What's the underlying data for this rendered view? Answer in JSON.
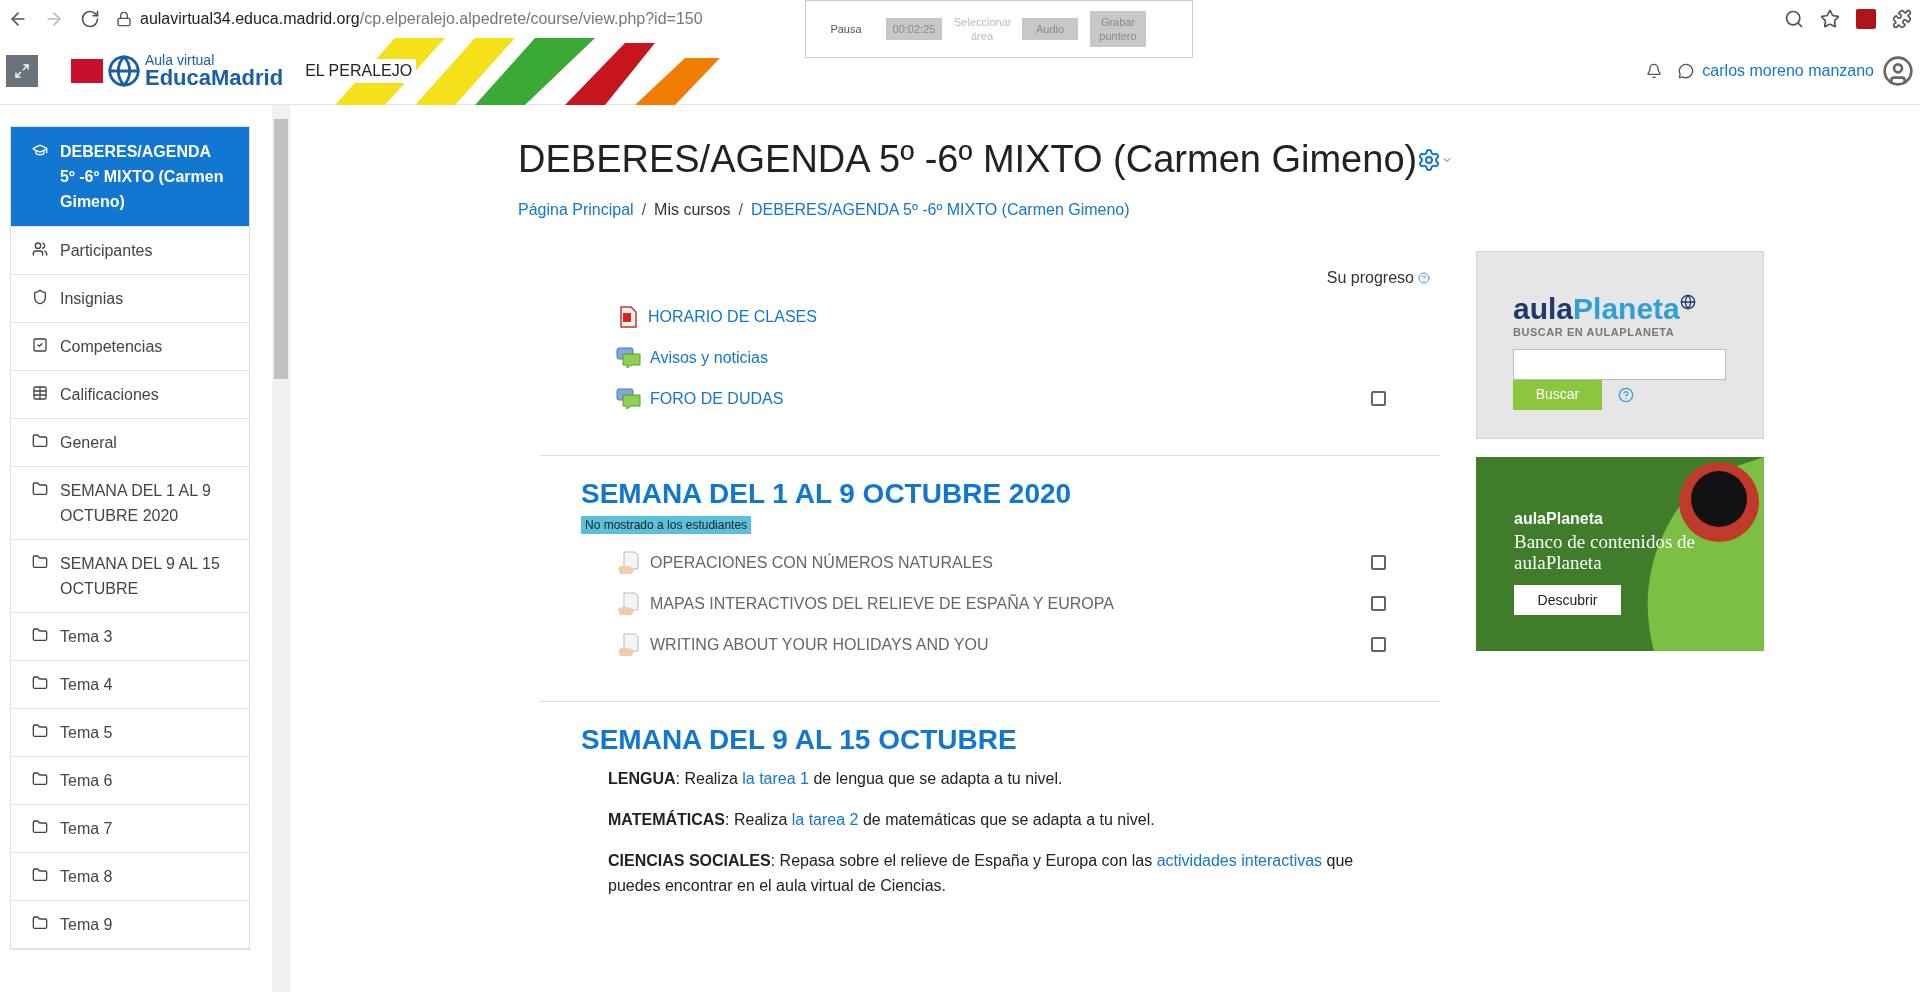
{
  "browser": {
    "url_host": "aulavirtual34.educa.madrid.org",
    "url_path": "/cp.elperalejo.alpedrete/course/view.php?id=150"
  },
  "recorder": [
    {
      "label": "Pausa",
      "kind": "plain"
    },
    {
      "label": "00:02:25",
      "kind": "boxed"
    },
    {
      "label": "Seleccionar área",
      "kind": "disabled"
    },
    {
      "label": "Audio",
      "kind": "boxed"
    },
    {
      "label": "Grabar puntero",
      "kind": "boxed"
    }
  ],
  "header": {
    "logo_small": "Aula virtual",
    "logo_big": "EducaMadrid",
    "site": "EL PERALEJO",
    "user": "carlos moreno manzano"
  },
  "sidebar": [
    {
      "label": "DEBERES/AGENDA 5º -6º MIXTO (Carmen Gimeno)",
      "kind": "course",
      "selected": true
    },
    {
      "label": "Participantes",
      "kind": "participants",
      "selected": false
    },
    {
      "label": "Insignias",
      "kind": "badges",
      "selected": false
    },
    {
      "label": "Competencias",
      "kind": "competencies",
      "selected": false
    },
    {
      "label": "Calificaciones",
      "kind": "grades",
      "selected": false
    },
    {
      "label": "General",
      "kind": "folder",
      "selected": false
    },
    {
      "label": "SEMANA DEL 1 AL 9 OCTUBRE 2020",
      "kind": "folder",
      "selected": false
    },
    {
      "label": "SEMANA DEL 9 AL 15 OCTUBRE",
      "kind": "folder",
      "selected": false
    },
    {
      "label": "Tema 3",
      "kind": "folder",
      "selected": false
    },
    {
      "label": "Tema 4",
      "kind": "folder",
      "selected": false
    },
    {
      "label": "Tema 5",
      "kind": "folder",
      "selected": false
    },
    {
      "label": "Tema 6",
      "kind": "folder",
      "selected": false
    },
    {
      "label": "Tema 7",
      "kind": "folder",
      "selected": false
    },
    {
      "label": "Tema 8",
      "kind": "folder",
      "selected": false
    },
    {
      "label": "Tema 9",
      "kind": "folder",
      "selected": false
    }
  ],
  "course": {
    "title": "DEBERES/AGENDA 5º -6º MIXTO (Carmen Gimeno)",
    "breadcrumb": [
      {
        "label": "Página Principal",
        "kind": "link"
      },
      {
        "label": "Mis cursos",
        "kind": "text"
      },
      {
        "label": "DEBERES/AGENDA 5º -6º MIXTO (Carmen Gimeno)",
        "kind": "link"
      }
    ],
    "separator": "/",
    "progress_label": "Su progreso"
  },
  "sections": [
    {
      "activities": [
        {
          "label": "HORARIO DE CLASES",
          "kind": "pdf",
          "dimmed": false
        },
        {
          "label": "Avisos y noticias",
          "kind": "forum",
          "dimmed": false
        },
        {
          "label": "FORO DE DUDAS",
          "kind": "forum",
          "dimmed": false,
          "completion": {
            "checked": false
          }
        }
      ]
    },
    {
      "title": "SEMANA DEL 1 AL 9 OCTUBRE 2020",
      "badge": "No mostrado a los estudiantes",
      "activities": [
        {
          "label": "OPERACIONES CON NÚMEROS NATURALES",
          "kind": "page",
          "dimmed": true,
          "completion": {
            "checked": false
          }
        },
        {
          "label": "MAPAS INTERACTIVOS DEL RELIEVE DE ESPAÑA Y EUROPA",
          "kind": "page",
          "dimmed": true,
          "completion": {
            "checked": false
          }
        },
        {
          "label": "WRITING ABOUT YOUR HOLIDAYS AND YOU",
          "kind": "page",
          "dimmed": true,
          "completion": {
            "checked": false
          }
        }
      ]
    },
    {
      "title": "SEMANA DEL 9 AL 15 OCTUBRE",
      "paragraphs": [
        [
          {
            "text": "LENGUA",
            "kind": "bold"
          },
          {
            "text": ": Realiza ",
            "kind": "plain"
          },
          {
            "text": "la tarea 1",
            "kind": "link"
          },
          {
            "text": " de lengua que se adapta a tu nivel.",
            "kind": "plain"
          }
        ],
        [
          {
            "text": "MATEMÁTICAS",
            "kind": "bold"
          },
          {
            "text": ": Realiza ",
            "kind": "plain"
          },
          {
            "text": "la tarea 2",
            "kind": "link"
          },
          {
            "text": " de matemáticas que se adapta a tu nivel.",
            "kind": "plain"
          }
        ],
        [
          {
            "text": "CIENCIAS SOCIALES",
            "kind": "bold"
          },
          {
            "text": ": Repasa sobre el relieve de España y Europa con las ",
            "kind": "plain"
          },
          {
            "text": "actividades interactivas",
            "kind": "link"
          },
          {
            "text": " que puedes encontrar en el aula virtual de Ciencias.",
            "kind": "plain"
          }
        ]
      ]
    }
  ],
  "blocks": {
    "search": {
      "logo_a": "aula",
      "logo_b": "Planeta",
      "subtitle": "BUSCAR EN AULAPLANETA",
      "button": "Buscar"
    },
    "ad": {
      "brand": "aulaPlaneta",
      "headline": "Banco de contenidos de aulaPlaneta",
      "button": "Descubrir"
    }
  }
}
